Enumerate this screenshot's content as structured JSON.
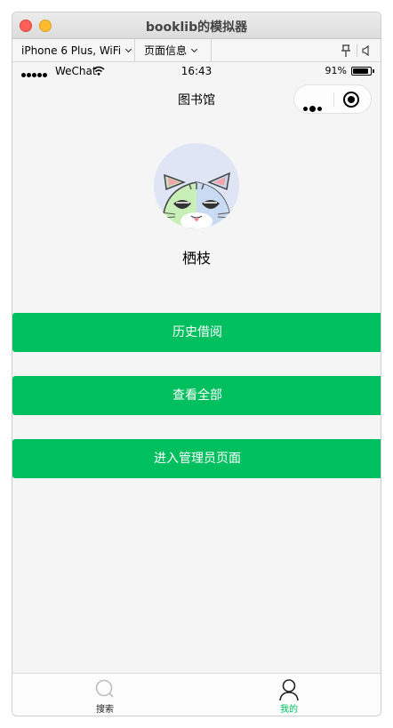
{
  "window": {
    "title": "booklib的模拟器"
  },
  "toolbar": {
    "device_label": "iPhone 6 Plus, WiFi",
    "page_info_label": "页面信息"
  },
  "statusbar": {
    "carrier": "WeChat",
    "time": "16:43",
    "battery_percent": "91%",
    "battery_level": 0.91
  },
  "navbar": {
    "title": "图书馆"
  },
  "profile": {
    "name": "栖枝"
  },
  "actions": {
    "history_label": "历史借阅",
    "view_all_label": "查看全部",
    "admin_label": "进入管理员页面"
  },
  "tabbar": {
    "search_label": "搜索",
    "mine_label": "我的",
    "active_color": "#00bf5f"
  },
  "colors": {
    "primary_green": "#00bf5f",
    "page_bg": "#f5f5f5"
  },
  "icons": {
    "search_tab": "search-icon",
    "mine_tab": "user-icon"
  }
}
